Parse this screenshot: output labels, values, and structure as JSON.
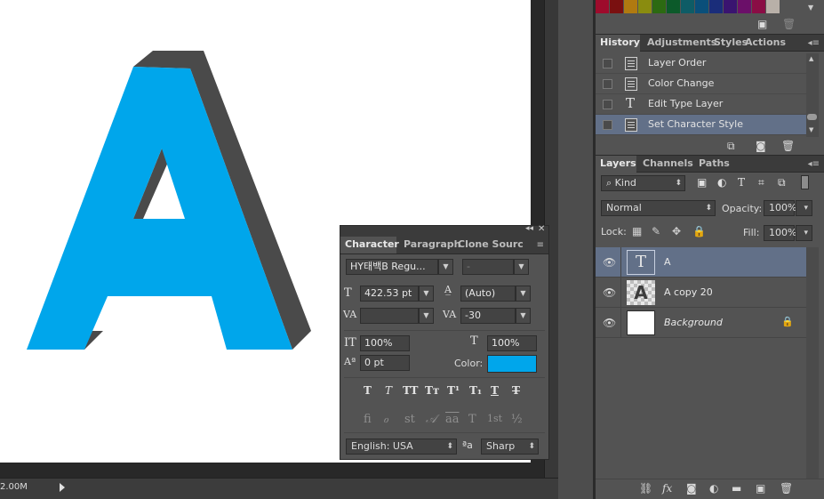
{
  "colors": {
    "accent_cyan": "#00a6eb",
    "extrude_gray": "#4a4a4a",
    "panel_bg": "#535353",
    "selection_blue": "#627088"
  },
  "canvas": {
    "letter": "A",
    "status_size": "2.00M"
  },
  "swatches": [
    "#9e0b2c",
    "#7a1010",
    "#b07a10",
    "#8a8c0f",
    "#2c6a12",
    "#0c5a2a",
    "#0e5c66",
    "#0a4f7a",
    "#1a2d7a",
    "#3a1470",
    "#6b0f69",
    "#8a0d45",
    "#b8b0a8"
  ],
  "history": {
    "tabs": [
      "History",
      "Adjustments",
      "Styles",
      "Actions"
    ],
    "items": [
      {
        "label": "Layer Order",
        "icon": "document-icon"
      },
      {
        "label": "Color Change",
        "icon": "document-icon"
      },
      {
        "label": "Edit Type Layer",
        "icon": "type-icon"
      },
      {
        "label": "Set Character Style",
        "icon": "document-icon"
      }
    ]
  },
  "layers": {
    "tabs": [
      "Layers",
      "Channels",
      "Paths"
    ],
    "filter_kind": "Kind",
    "blend_mode": "Normal",
    "opacity_label": "Opacity:",
    "opacity_value": "100%",
    "lock_label": "Lock:",
    "fill_label": "Fill:",
    "fill_value": "100%",
    "items": [
      {
        "name": "A",
        "type": "text"
      },
      {
        "name": "A copy 20",
        "type": "raster"
      },
      {
        "name": "Background",
        "type": "background"
      }
    ],
    "thumb_glyph_text": "T",
    "thumb_glyph_raster": "A"
  },
  "character": {
    "tabs": [
      "Character",
      "Paragraph",
      "Clone Sourc"
    ],
    "font_family": "HY태백B Regu...",
    "font_style": "-",
    "font_size": "422.53 pt",
    "leading": "(Auto)",
    "kerning": "",
    "tracking": "-30",
    "vertical_scale": "100%",
    "horizontal_scale": "100%",
    "baseline_shift": "0 pt",
    "color_label": "Color:",
    "color_value": "#00a6eb",
    "type_buttons": [
      "T",
      "T",
      "TT",
      "Tт",
      "T¹",
      "T₁",
      "T",
      "T"
    ],
    "opentype_buttons": [
      "ﬁ",
      "ℴ",
      "st",
      "𝒜",
      "aa",
      "T",
      "1st",
      "½"
    ],
    "language": "English: USA",
    "aa_label": "ªa",
    "antialias": "Sharp"
  }
}
